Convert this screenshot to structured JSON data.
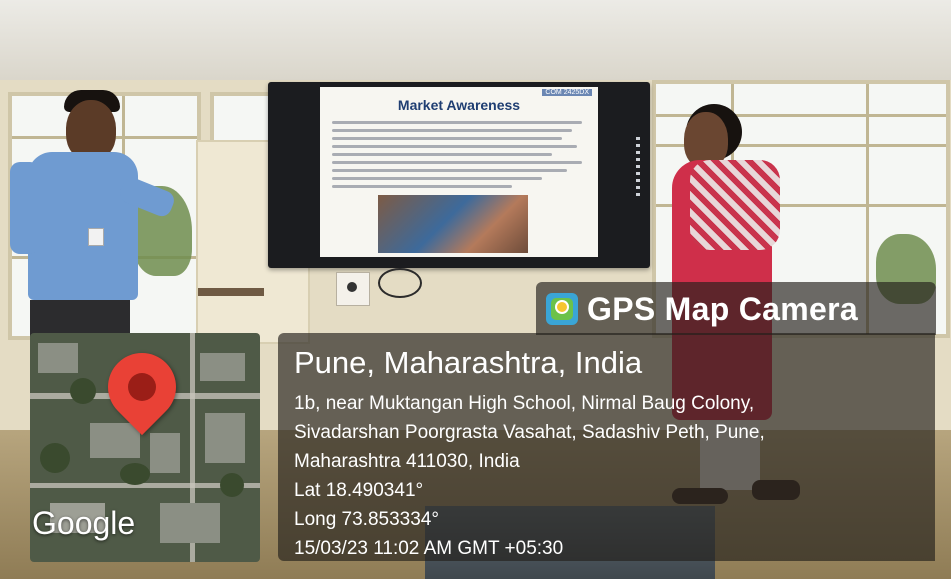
{
  "watermark": {
    "app_name": "GPS Map Camera",
    "app_icon": "gps-map-camera-icon",
    "map_provider": "Google",
    "location_title": "Pune, Maharashtra, India",
    "address_lines": [
      "1b, near Muktangan High School, Nirmal Baug Colony,",
      "Sivadarshan Poorgrasta Vasahat, Sadashiv Peth, Pune,",
      "Maharashtra 411030, India"
    ],
    "latitude": "Lat 18.490341°",
    "longitude": "Long 73.853334°",
    "timestamp": "15/03/23 11:02 AM GMT +05:30",
    "pin_icon": "map-pin-icon",
    "pin_color": "#e94136"
  },
  "slide": {
    "title": "Market Awareness",
    "code": "COM 2425DX"
  }
}
